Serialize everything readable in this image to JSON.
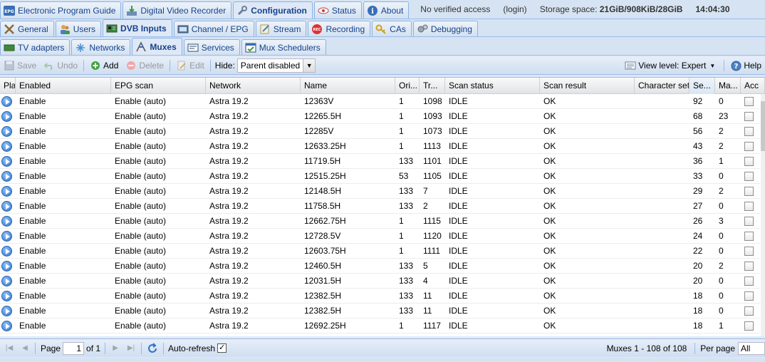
{
  "top_tabs": [
    {
      "label": "Electronic Program Guide",
      "icon": "epg-icon"
    },
    {
      "label": "Digital Video Recorder",
      "icon": "dvr-icon"
    },
    {
      "label": "Configuration",
      "icon": "wrench-icon",
      "active": true
    },
    {
      "label": "Status",
      "icon": "eye-icon"
    },
    {
      "label": "About",
      "icon": "info-icon"
    }
  ],
  "status": {
    "access": "No verified access",
    "login": "(login)",
    "storage_label": "Storage space:",
    "storage_value": "21GiB/908KiB/28GiB",
    "time": "14:04:30"
  },
  "sub_tabs": [
    {
      "label": "General",
      "icon": "tools-icon"
    },
    {
      "label": "Users",
      "icon": "users-icon"
    },
    {
      "label": "DVB Inputs",
      "icon": "tv-card-icon",
      "active": true
    },
    {
      "label": "Channel / EPG",
      "icon": "tv-icon"
    },
    {
      "label": "Stream",
      "icon": "stream-icon"
    },
    {
      "label": "Recording",
      "icon": "rec-icon"
    },
    {
      "label": "CAs",
      "icon": "key-icon"
    },
    {
      "label": "Debugging",
      "icon": "gears-icon"
    }
  ],
  "dvb_tabs": [
    {
      "label": "TV adapters",
      "icon": "adapter-icon"
    },
    {
      "label": "Networks",
      "icon": "network-icon"
    },
    {
      "label": "Muxes",
      "icon": "muxes-icon",
      "active": true
    },
    {
      "label": "Services",
      "icon": "services-icon"
    },
    {
      "label": "Mux Schedulers",
      "icon": "scheduler-icon"
    }
  ],
  "toolbar": {
    "save": "Save",
    "undo": "Undo",
    "add": "Add",
    "delete": "Delete",
    "edit": "Edit",
    "hide_label": "Hide:",
    "hide_value": "Parent disabled",
    "view_level": "View level: Expert",
    "help": "Help"
  },
  "columns": [
    "Play",
    "Enabled",
    "EPG scan",
    "Network",
    "Name",
    "Ori...",
    "Tr...",
    "Scan status",
    "Scan result",
    "Character set",
    "Se...",
    "Ma...",
    "Acc"
  ],
  "rows": [
    [
      "Enable",
      "Enable (auto)",
      "Astra 19.2",
      "12363V",
      "1",
      "1098",
      "IDLE",
      "OK",
      "",
      "92",
      "0"
    ],
    [
      "Enable",
      "Enable (auto)",
      "Astra 19.2",
      "12265.5H",
      "1",
      "1093",
      "IDLE",
      "OK",
      "",
      "68",
      "23"
    ],
    [
      "Enable",
      "Enable (auto)",
      "Astra 19.2",
      "12285V",
      "1",
      "1073",
      "IDLE",
      "OK",
      "",
      "56",
      "2"
    ],
    [
      "Enable",
      "Enable (auto)",
      "Astra 19.2",
      "12633.25H",
      "1",
      "1113",
      "IDLE",
      "OK",
      "",
      "43",
      "2"
    ],
    [
      "Enable",
      "Enable (auto)",
      "Astra 19.2",
      "11719.5H",
      "133",
      "1101",
      "IDLE",
      "OK",
      "",
      "36",
      "1"
    ],
    [
      "Enable",
      "Enable (auto)",
      "Astra 19.2",
      "12515.25H",
      "53",
      "1105",
      "IDLE",
      "OK",
      "",
      "33",
      "0"
    ],
    [
      "Enable",
      "Enable (auto)",
      "Astra 19.2",
      "12148.5H",
      "133",
      "7",
      "IDLE",
      "OK",
      "",
      "29",
      "2"
    ],
    [
      "Enable",
      "Enable (auto)",
      "Astra 19.2",
      "11758.5H",
      "133",
      "2",
      "IDLE",
      "OK",
      "",
      "27",
      "0"
    ],
    [
      "Enable",
      "Enable (auto)",
      "Astra 19.2",
      "12662.75H",
      "1",
      "1115",
      "IDLE",
      "OK",
      "",
      "26",
      "3"
    ],
    [
      "Enable",
      "Enable (auto)",
      "Astra 19.2",
      "12728.5V",
      "1",
      "1120",
      "IDLE",
      "OK",
      "",
      "24",
      "0"
    ],
    [
      "Enable",
      "Enable (auto)",
      "Astra 19.2",
      "12603.75H",
      "1",
      "1111",
      "IDLE",
      "OK",
      "",
      "22",
      "0"
    ],
    [
      "Enable",
      "Enable (auto)",
      "Astra 19.2",
      "12460.5H",
      "133",
      "5",
      "IDLE",
      "OK",
      "",
      "20",
      "2"
    ],
    [
      "Enable",
      "Enable (auto)",
      "Astra 19.2",
      "12031.5H",
      "133",
      "4",
      "IDLE",
      "OK",
      "",
      "20",
      "0"
    ],
    [
      "Enable",
      "Enable (auto)",
      "Astra 19.2",
      "12382.5H",
      "133",
      "11",
      "IDLE",
      "OK",
      "",
      "18",
      "0"
    ],
    [
      "Enable",
      "Enable (auto)",
      "Astra 19.2",
      "12382.5H",
      "133",
      "11",
      "IDLE",
      "OK",
      "",
      "18",
      "0"
    ],
    [
      "Enable",
      "Enable (auto)",
      "Astra 19.2",
      "12692.25H",
      "1",
      "1117",
      "IDLE",
      "OK",
      "",
      "18",
      "1"
    ]
  ],
  "pager": {
    "page_label": "Page",
    "page_value": "1",
    "of_label": "of 1",
    "auto_refresh": "Auto-refresh",
    "summary": "Muxes 1 - 108 of 108",
    "per_page_label": "Per page",
    "per_page_value": "All"
  }
}
